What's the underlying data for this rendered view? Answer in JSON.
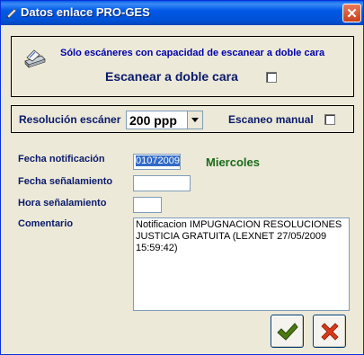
{
  "window": {
    "title": "Datos enlace PRO-GES",
    "close_symbol": "✕"
  },
  "scan_panel": {
    "note": "Sólo escáneres con capacidad de escanear a doble cara",
    "dual_label": "Escanear a doble cara",
    "dual_checked": false
  },
  "resolution_panel": {
    "label": "Resolución escáner",
    "selected_value": "200 ppp",
    "manual_label": "Escaneo manual",
    "manual_checked": false
  },
  "form": {
    "fecha_notificacion_label": "Fecha notificación",
    "fecha_notificacion_value": "01072009",
    "weekday": "Miercoles",
    "fecha_senalamiento_label": "Fecha señalamiento",
    "fecha_senalamiento_value": "",
    "hora_senalamiento_label": "Hora señalamiento",
    "hora_senalamiento_value": "",
    "comentario_label": "Comentario",
    "comentario_value": "Notificacion IMPUGNACION RESOLUCIONES JUSTICIA GRATUITA (LEXNET 27/05/2009 15:59:42)"
  },
  "buttons": {
    "ok_icon": "checkmark-icon",
    "cancel_icon": "x-icon"
  },
  "colors": {
    "titlebar": "#0058e6",
    "label_text": "#0a1a6a",
    "note_text": "#0000aa",
    "weekday_text": "#1a6a1a",
    "ok_green": "#4a7a10",
    "cancel_red": "#d83a1a"
  }
}
